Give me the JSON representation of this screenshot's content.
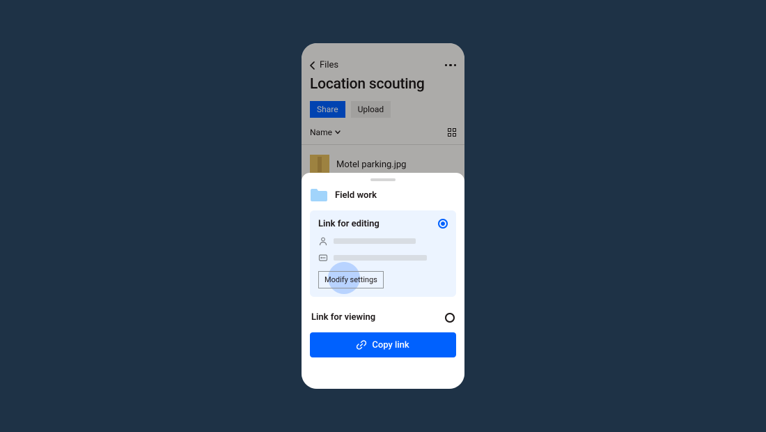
{
  "colors": {
    "accent": "#0061fe",
    "bg": "#1e3246"
  },
  "nav": {
    "back_label": "Files"
  },
  "page": {
    "title": "Location scouting",
    "share_btn": "Share",
    "upload_btn": "Upload",
    "sort_label": "Name"
  },
  "file_list": {
    "items": [
      {
        "name": "Motel parking.jpg"
      }
    ]
  },
  "sheet": {
    "folder_name": "Field work",
    "options": {
      "editing": {
        "title": "Link for editing",
        "selected": true,
        "modify_btn": "Modify settings"
      },
      "viewing": {
        "title": "Link for viewing",
        "selected": false
      }
    },
    "copy_btn": "Copy link"
  }
}
